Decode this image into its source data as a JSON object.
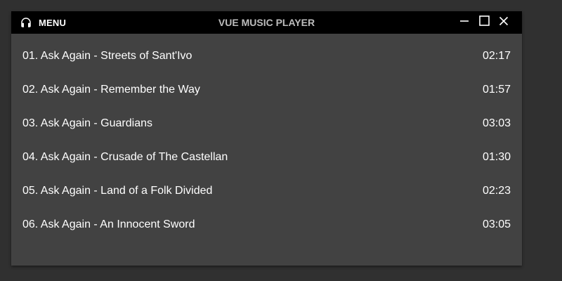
{
  "titlebar": {
    "menu_label": "MENU",
    "app_title": "VUE MUSIC PLAYER",
    "icons": {
      "menu": "headphones-icon",
      "minimize": "minimize-icon",
      "maximize": "maximize-icon",
      "close": "close-icon"
    }
  },
  "colors": {
    "background": "#303030",
    "window": "#424242",
    "titlebar": "#000000",
    "text": "#ffffff",
    "title_text": "#bdbdbd"
  },
  "tracks": [
    {
      "title": "01. Ask Again - Streets of Sant'Ivo",
      "duration": "02:17"
    },
    {
      "title": "02. Ask Again - Remember the Way",
      "duration": "01:57"
    },
    {
      "title": "03. Ask Again - Guardians",
      "duration": "03:03"
    },
    {
      "title": "04. Ask Again - Crusade of The Castellan",
      "duration": "01:30"
    },
    {
      "title": "05. Ask Again - Land of a Folk Divided",
      "duration": "02:23"
    },
    {
      "title": "06. Ask Again - An Innocent Sword",
      "duration": "03:05"
    }
  ]
}
